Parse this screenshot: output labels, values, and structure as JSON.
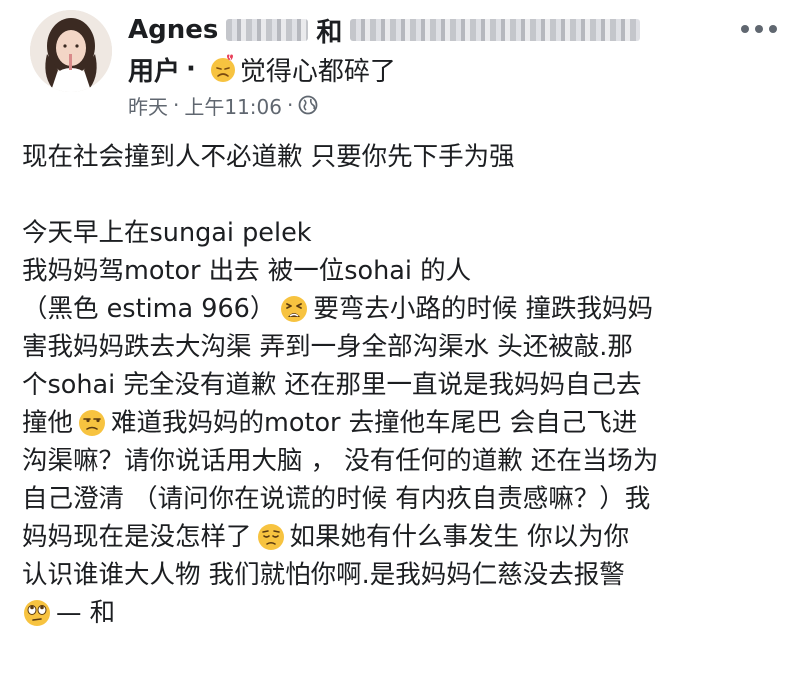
{
  "header": {
    "author_name": "Agnes",
    "connector": "和",
    "line2_prefix": "用户",
    "separator": "·",
    "feeling_text": "觉得心都碎了",
    "feeling_icon": "broken-heart-face-icon"
  },
  "meta": {
    "day": "昨天",
    "separator": "·",
    "time": "上午11:06",
    "audience_icon": "globe-icon"
  },
  "post": {
    "l1": "现在社会撞到人不必道歉 只要你先下手为强",
    "l2": "今天早上在sungai pelek",
    "l3": "我妈妈驾motor 出去 被一位sohai 的人",
    "l4a": "（黑色 estima 966）",
    "l4b": "要弯去小路的时候 撞跌我妈妈",
    "l5": "害我妈妈跌去大沟渠 弄到一身全部沟渠水 头还被敲.那",
    "l6": "个sohai 完全没有道歉 还在那里一直说是我妈妈自己去",
    "l7a": "撞他",
    "l7b": "难道我妈妈的motor 去撞他车尾巴 会自己飞进",
    "l8": "沟渠嘛？请你说话用大脑 ， 没有任何的道歉 还在当场为",
    "l9": "自己澄清 （请问你在说谎的时候 有内疚自责感嘛？）我",
    "l10a": "妈妈现在是没怎样了",
    "l10b": "如果她有什么事发生 你以为你",
    "l11": "认识谁谁大人物 我们就怕你啊.是我妈妈仁慈没去报警",
    "l12": "— 和"
  },
  "emojis": {
    "tired": "tired-face-emoji",
    "unamused": "unamused-face-emoji",
    "pensive": "pensive-face-emoji",
    "eye_roll": "eye-roll-face-emoji"
  },
  "colors": {
    "text": "#1c1e21",
    "meta": "#606770",
    "emoji_yellow": "#f7c340"
  }
}
